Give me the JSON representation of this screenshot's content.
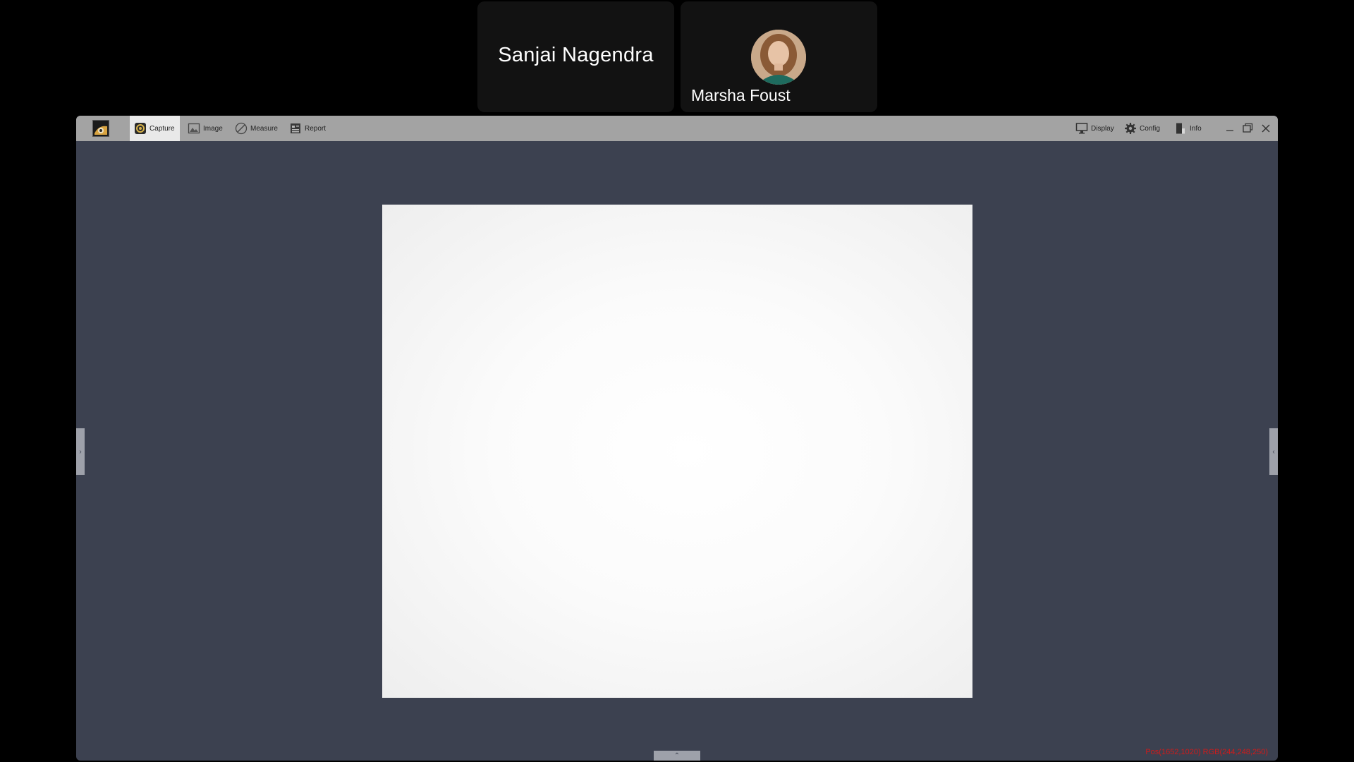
{
  "meeting": {
    "participants": [
      {
        "name": "Sanjai Nagendra",
        "has_avatar": false
      },
      {
        "name": "Marsha Foust",
        "has_avatar": true
      }
    ]
  },
  "app": {
    "toolbar": {
      "logo_icon": "app-logo-icon",
      "tools": [
        {
          "label": "Capture",
          "icon": "capture-icon",
          "active": true
        },
        {
          "label": "Image",
          "icon": "image-icon",
          "active": false
        },
        {
          "label": "Measure",
          "icon": "measure-icon",
          "active": false
        },
        {
          "label": "Report",
          "icon": "report-icon",
          "active": false
        }
      ],
      "right_tools": [
        {
          "label": "Display",
          "icon": "monitor-icon"
        },
        {
          "label": "Config",
          "icon": "gear-icon"
        },
        {
          "label": "Info",
          "icon": "info-icon"
        }
      ],
      "window_controls": [
        "minimize-icon",
        "restore-icon",
        "close-icon"
      ]
    },
    "status": {
      "pixel_readout": "Pos(1652,1020) RGB(244,248,250)"
    },
    "colors": {
      "workspace_bg": "#3c4150",
      "toolbar_bg": "#a3a3a3",
      "active_tool_bg": "#e9e9e9",
      "readout_color": "#d11a1a"
    }
  }
}
